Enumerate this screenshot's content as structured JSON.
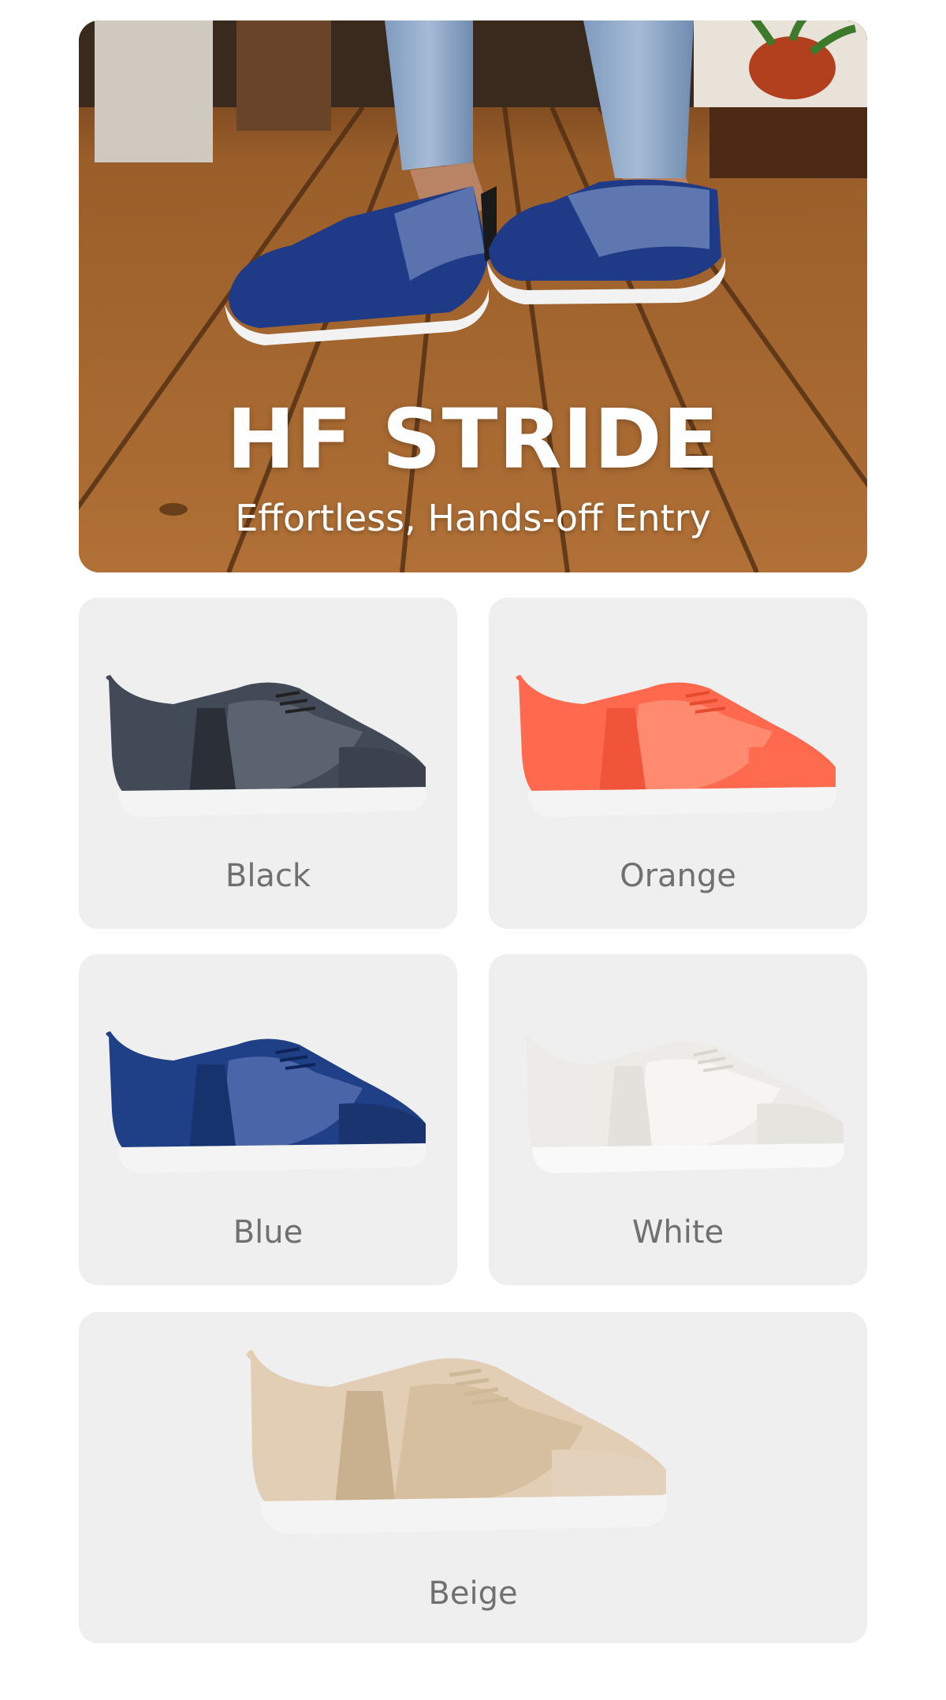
{
  "hero": {
    "title": "HF STRIDE",
    "subtitle": "Effortless, Hands-off Entry"
  },
  "colors": [
    {
      "label": "Black",
      "upper": "#434a57",
      "mesh": "#5b6270",
      "toe": "#3b414d"
    },
    {
      "label": "Orange",
      "upper": "#ff6a4f",
      "mesh": "#ff7f63",
      "toe": "#ff6b4e"
    },
    {
      "label": "Blue",
      "upper": "#1f3f86",
      "mesh": "#2a4a92",
      "toe": "#1a346f"
    },
    {
      "label": "White",
      "upper": "#ecebe7",
      "mesh": "#f2f1ed",
      "toe": "#e6e4de"
    },
    {
      "label": "Beige",
      "upper": "#e2cdb5",
      "mesh": "#d8c2a6",
      "toe": "#e4d1bb"
    }
  ]
}
